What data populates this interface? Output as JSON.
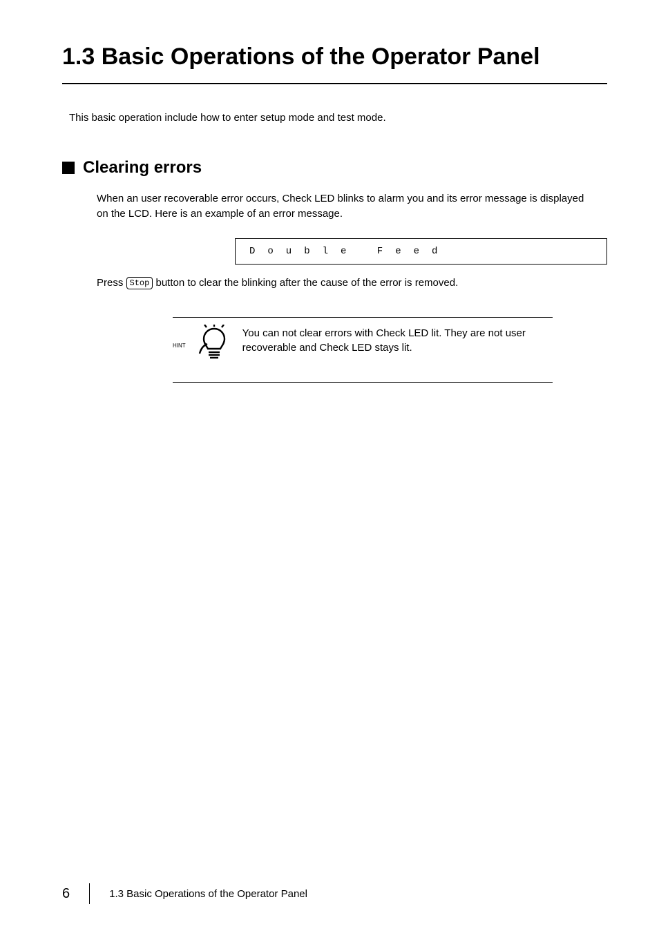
{
  "title": "1.3  Basic Operations of the Operator Panel",
  "intro": "This basic operation include how to enter setup mode and test mode.",
  "section": {
    "heading": "Clearing errors",
    "para1": "When an user recoverable error occurs, Check LED blinks to alarm you and its error message is displayed on the LCD. Here is an example of an error message.",
    "lcd_text": "Double Feed",
    "press_before": "Press ",
    "stop_label": "Stop",
    "press_after": " button to clear the blinking after the cause of the error is removed."
  },
  "hint": {
    "label": "HINT",
    "text": "You can not clear errors with Check LED lit. They are not user recoverable and Check LED stays lit."
  },
  "footer": {
    "page_number": "6",
    "footer_text": "1.3  Basic Operations of the Operator Panel"
  }
}
